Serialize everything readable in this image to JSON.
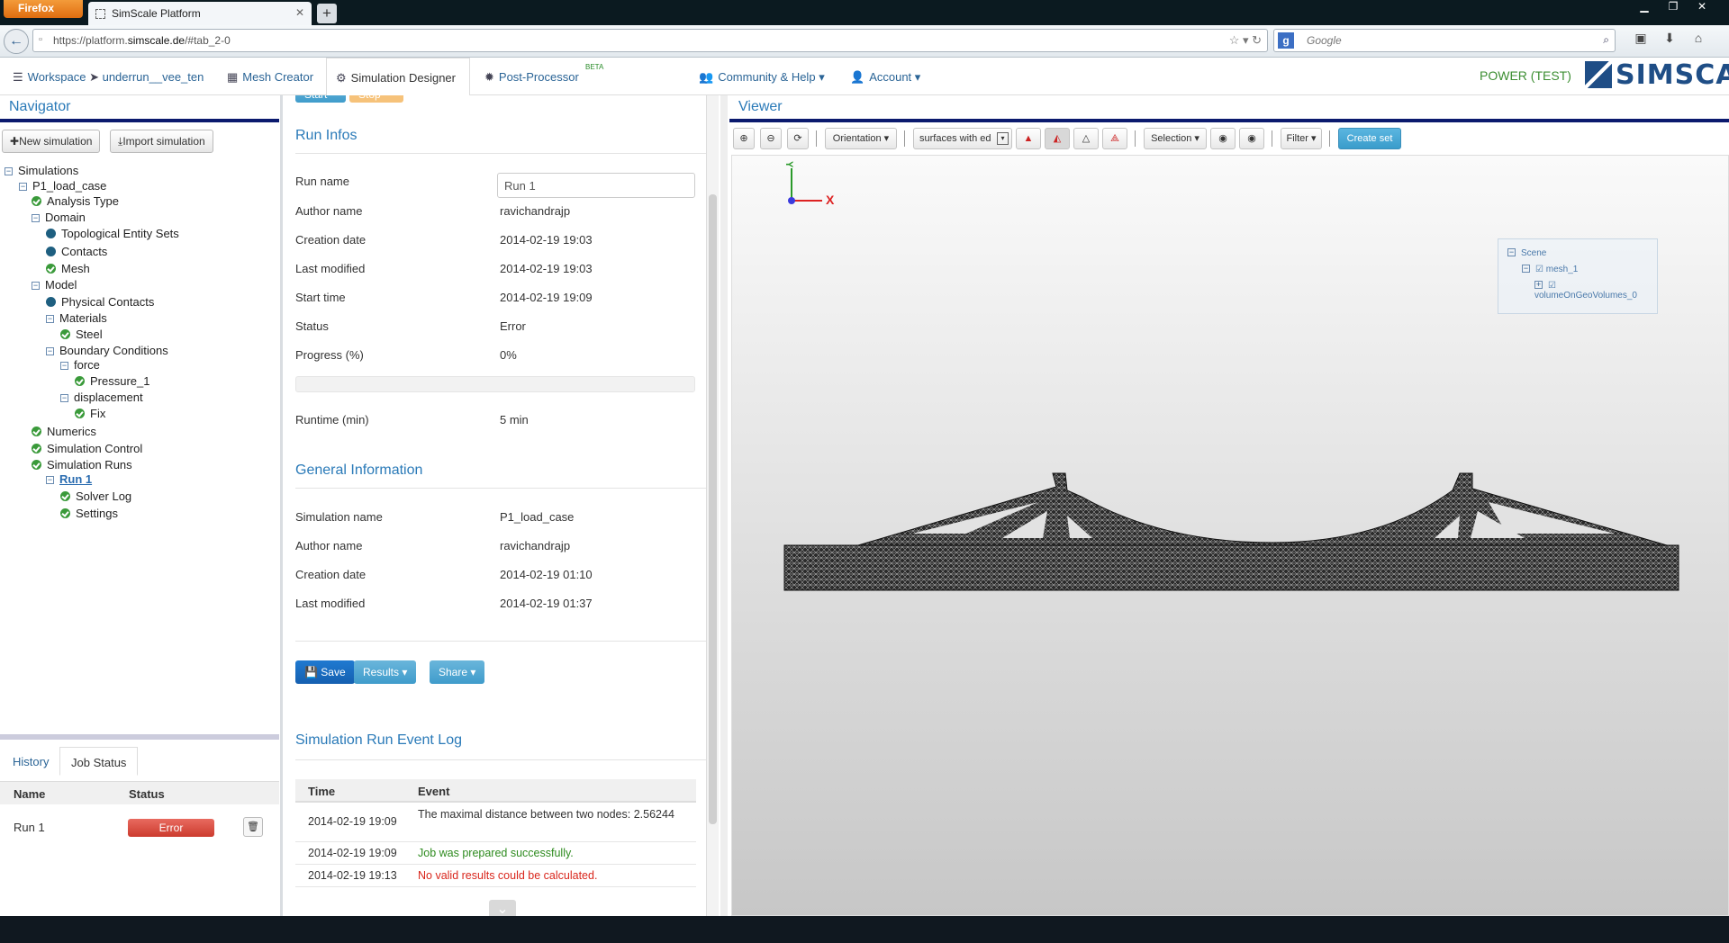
{
  "browser": {
    "menu_label": "Firefox",
    "tab_title": "SimScale Platform",
    "url_prefix": "https://platform.",
    "url_domain": "simscale.de",
    "url_suffix": "/#tab_2-0",
    "search_placeholder": "Google"
  },
  "app": {
    "nav": {
      "workspace": "Workspace",
      "project": "underrun__vee_ten",
      "mesh_creator": "Mesh Creator",
      "simulation_designer": "Simulation Designer",
      "post_processor": "Post-Processor",
      "beta": "BETA",
      "community": "Community & Help",
      "account": "Account"
    },
    "plan": "POWER (TEST)",
    "logo": "SIMSCALE"
  },
  "navigator": {
    "title": "Navigator",
    "new_simulation": "New simulation",
    "import_simulation": "Import simulation",
    "tree": {
      "simulations": "Simulations",
      "p1": "P1_load_case",
      "analysis_type": "Analysis Type",
      "domain": "Domain",
      "topo": "Topological Entity Sets",
      "contacts": "Contacts",
      "mesh": "Mesh",
      "model": "Model",
      "physical_contacts": "Physical Contacts",
      "materials": "Materials",
      "steel": "Steel",
      "boundary_conditions": "Boundary Conditions",
      "force": "force",
      "pressure": "Pressure_1",
      "displacement": "displacement",
      "fix": "Fix",
      "numerics": "Numerics",
      "simulation_control": "Simulation Control",
      "simulation_runs": "Simulation Runs",
      "run1": "Run 1",
      "solver_log": "Solver Log",
      "settings": "Settings"
    }
  },
  "jobs": {
    "tab_history": "History",
    "tab_job_status": "Job Status",
    "col_name": "Name",
    "col_status": "Status",
    "row_name": "Run 1",
    "row_status": "Error"
  },
  "run_infos": {
    "title": "Run Infos",
    "run_name_label": "Run name",
    "run_name_value": "Run 1",
    "author_label": "Author name",
    "author_value": "ravichandrajp",
    "creation_label": "Creation date",
    "creation_value": "2014-02-19 19:03",
    "modified_label": "Last modified",
    "modified_value": "2014-02-19 19:03",
    "start_label": "Start time",
    "start_value": "2014-02-19 19:09",
    "status_label": "Status",
    "status_value": "Error",
    "progress_label": "Progress (%)",
    "progress_value": "0%",
    "runtime_label": "Runtime (min)",
    "runtime_value": "5 min"
  },
  "general": {
    "title": "General Information",
    "sim_name_label": "Simulation name",
    "sim_name_value": "P1_load_case",
    "author_label": "Author name",
    "author_value": "ravichandrajp",
    "creation_label": "Creation date",
    "creation_value": "2014-02-19 01:10",
    "modified_label": "Last modified",
    "modified_value": "2014-02-19 01:37"
  },
  "actions": {
    "save": "Save",
    "results": "Results",
    "share": "Share",
    "start": "Start",
    "stop": "Stop"
  },
  "event_log": {
    "title": "Simulation Run Event Log",
    "col_time": "Time",
    "col_event": "Event",
    "rows": [
      {
        "time": "2014-02-19 19:09",
        "event": "The maximal distance between two nodes: 2.56244",
        "color": "#333333"
      },
      {
        "time": "2014-02-19 19:09",
        "event": "Job was prepared successfully.",
        "color": "#2e8b1f"
      },
      {
        "time": "2014-02-19 19:13",
        "event": "No valid results could be calculated.",
        "color": "#d9261c"
      }
    ]
  },
  "viewer": {
    "title": "Viewer",
    "orientation": "Orientation",
    "render_mode": "surfaces with ed",
    "selection": "Selection",
    "filter": "Filter",
    "create_set": "Create set",
    "axis_x": "X",
    "axis_y": "Y",
    "scene_root": "Scene",
    "scene_mesh": "mesh_1",
    "scene_volume": "volumeOnGeoVolumes_0"
  },
  "colors": {
    "accent": "#2a7ab8",
    "header_bar": "#0b1a6e",
    "ok": "#3a9a3a",
    "error": "#d9261c"
  }
}
